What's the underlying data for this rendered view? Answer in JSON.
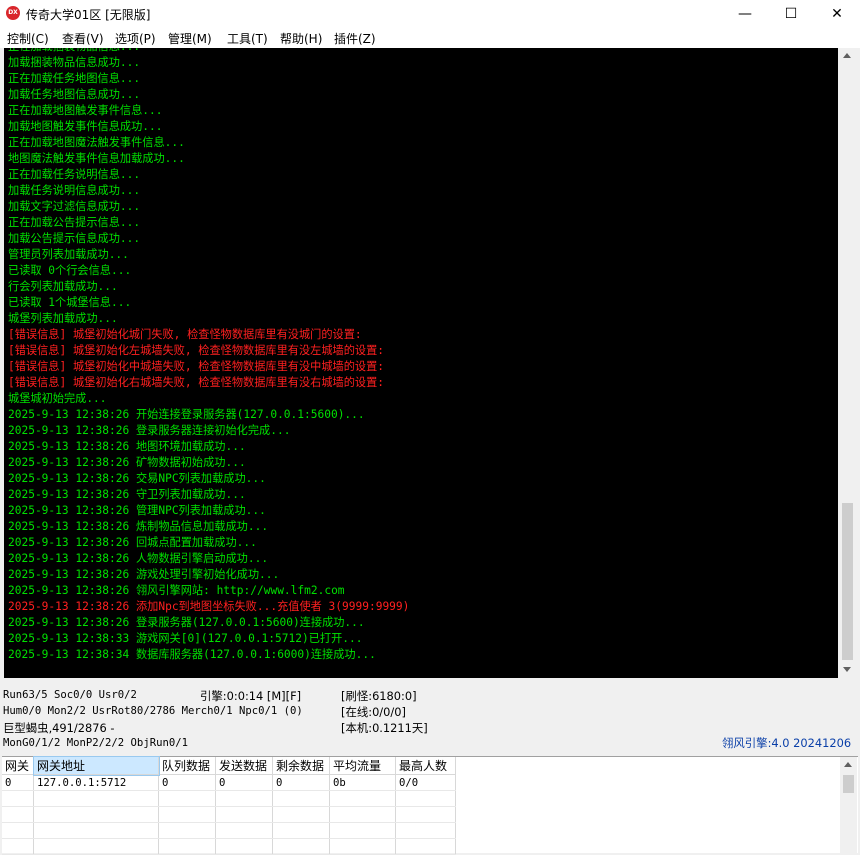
{
  "window": {
    "icon_text": "DX",
    "title": "传奇大学01区 [无限版]",
    "minimize": "—",
    "maximize": "☐",
    "close": "✕"
  },
  "menu": [
    "控制(C)",
    "查看(V)",
    "选项(P)",
    "管理(M)",
    "工具(T)",
    "帮助(H)",
    "插件(Z)"
  ],
  "console": {
    "lines": [
      {
        "text": "正在加载捆装物品信息...",
        "color": "green"
      },
      {
        "text": "加载捆装物品信息成功...",
        "color": "green"
      },
      {
        "text": "正在加载任务地图信息...",
        "color": "green"
      },
      {
        "text": "加载任务地图信息成功...",
        "color": "green"
      },
      {
        "text": "正在加载地图触发事件信息...",
        "color": "green"
      },
      {
        "text": "加载地图触发事件信息成功...",
        "color": "green"
      },
      {
        "text": "正在加载地图魔法触发事件信息...",
        "color": "green"
      },
      {
        "text": "地图魔法触发事件信息加载成功...",
        "color": "green"
      },
      {
        "text": "正在加载任务说明信息...",
        "color": "green"
      },
      {
        "text": "加载任务说明信息成功...",
        "color": "green"
      },
      {
        "text": "加载文字过滤信息成功...",
        "color": "green"
      },
      {
        "text": "正在加载公告提示信息...",
        "color": "green"
      },
      {
        "text": "加载公告提示信息成功...",
        "color": "green"
      },
      {
        "text": "管理员列表加载成功...",
        "color": "green"
      },
      {
        "text": "已读取 0个行会信息...",
        "color": "green"
      },
      {
        "text": "行会列表加载成功...",
        "color": "green"
      },
      {
        "text": "已读取 1个城堡信息...",
        "color": "green"
      },
      {
        "text": "城堡列表加载成功...",
        "color": "green"
      },
      {
        "text": "[错误信息] 城堡初始化城门失败, 检查怪物数据库里有没城门的设置:",
        "color": "red"
      },
      {
        "text": "[错误信息] 城堡初始化左城墙失败, 检查怪物数据库里有没左城墙的设置:",
        "color": "red"
      },
      {
        "text": "[错误信息] 城堡初始化中城墙失败, 检查怪物数据库里有没中城墙的设置:",
        "color": "red"
      },
      {
        "text": "[错误信息] 城堡初始化右城墙失败, 检查怪物数据库里有没右城墙的设置:",
        "color": "red"
      },
      {
        "text": "城堡城初始完成...",
        "color": "green"
      },
      {
        "text": "2025-9-13 12:38:26 开始连接登录服务器(127.0.0.1:5600)...",
        "color": "green"
      },
      {
        "text": "2025-9-13 12:38:26 登录服务器连接初始化完成...",
        "color": "green"
      },
      {
        "text": "2025-9-13 12:38:26 地图环境加载成功...",
        "color": "green"
      },
      {
        "text": "2025-9-13 12:38:26 矿物数据初始成功...",
        "color": "green"
      },
      {
        "text": "2025-9-13 12:38:26 交易NPC列表加载成功...",
        "color": "green"
      },
      {
        "text": "2025-9-13 12:38:26 守卫列表加载成功...",
        "color": "green"
      },
      {
        "text": "2025-9-13 12:38:26 管理NPC列表加载成功...",
        "color": "green"
      },
      {
        "text": "2025-9-13 12:38:26 炼制物品信息加载成功...",
        "color": "green"
      },
      {
        "text": "2025-9-13 12:38:26 回城点配置加载成功...",
        "color": "green"
      },
      {
        "text": "2025-9-13 12:38:26 人物数据引擎启动成功...",
        "color": "green"
      },
      {
        "text": "2025-9-13 12:38:26 游戏处理引擎初始化成功...",
        "color": "green"
      },
      {
        "text": "2025-9-13 12:38:26 翎风引擎网站: http://www.lfm2.com",
        "color": "green"
      },
      {
        "text": "2025-9-13 12:38:26 添加Npc到地图坐标失败...充值使者 3(9999:9999)",
        "color": "red"
      },
      {
        "text": "2025-9-13 12:38:26 登录服务器(127.0.0.1:5600)连接成功...",
        "color": "green"
      },
      {
        "text": "2025-9-13 12:38:33 游戏网关[0](127.0.0.1:5712)已打开...",
        "color": "green"
      },
      {
        "text": "2025-9-13 12:38:34 数据库服务器(127.0.0.1:6000)连接成功...",
        "color": "green"
      }
    ]
  },
  "status": {
    "run": "Run63/5 Soc0/0 Usr0/2",
    "engine_time": "引擎:0:0:14 [M][F]",
    "refresh": "[刷怪:6180:0]",
    "hum": "Hum0/0 Mon2/2 UsrRot80/2786 Merch0/1 Npc0/1 (0)",
    "online": "[在线:0/0/0]",
    "monster": "巨型蝎虫,491/2876 -",
    "machine": "[本机:0.1211天]",
    "mongroup": "MonG0/1/2 MonP2/2/2 ObjRun0/1",
    "engine_version": "翎风引擎:4.0 20241206"
  },
  "gate_table": {
    "headers": [
      "网关",
      "网关地址",
      "队列数据",
      "发送数据",
      "剩余数据",
      "平均流量",
      "最高人数"
    ],
    "rows": [
      [
        "0",
        "127.0.0.1:5712",
        "0",
        "0",
        "0",
        "0b",
        "0/0"
      ],
      [
        "",
        "",
        "",
        "",
        "",
        "",
        ""
      ],
      [
        "",
        "",
        "",
        "",
        "",
        "",
        ""
      ],
      [
        "",
        "",
        "",
        "",
        "",
        "",
        ""
      ],
      [
        "",
        "",
        "",
        "",
        "",
        "",
        ""
      ]
    ]
  }
}
